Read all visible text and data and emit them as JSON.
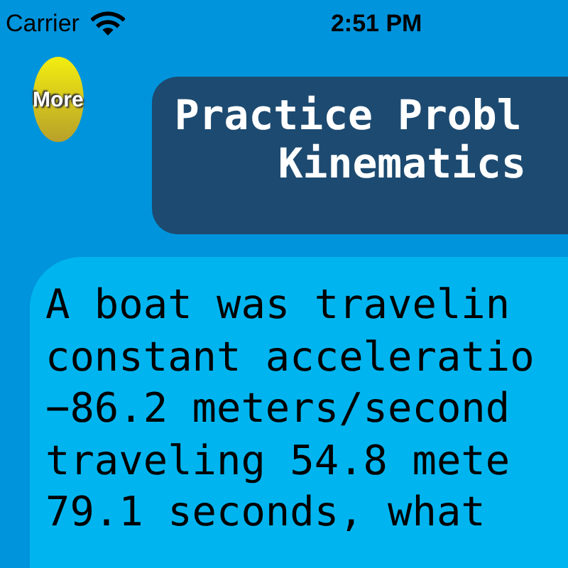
{
  "status_bar": {
    "carrier": "Carrier",
    "time": "2:51 PM"
  },
  "more_button": {
    "label": "More"
  },
  "title": {
    "lines": [
      "Practice Probl",
      "Kinematics"
    ]
  },
  "question": {
    "lines": [
      "A boat was travelin",
      "constant acceleratio",
      "−86.2 meters/second",
      "traveling 54.8 mete",
      "79.1 seconds, what"
    ]
  }
}
